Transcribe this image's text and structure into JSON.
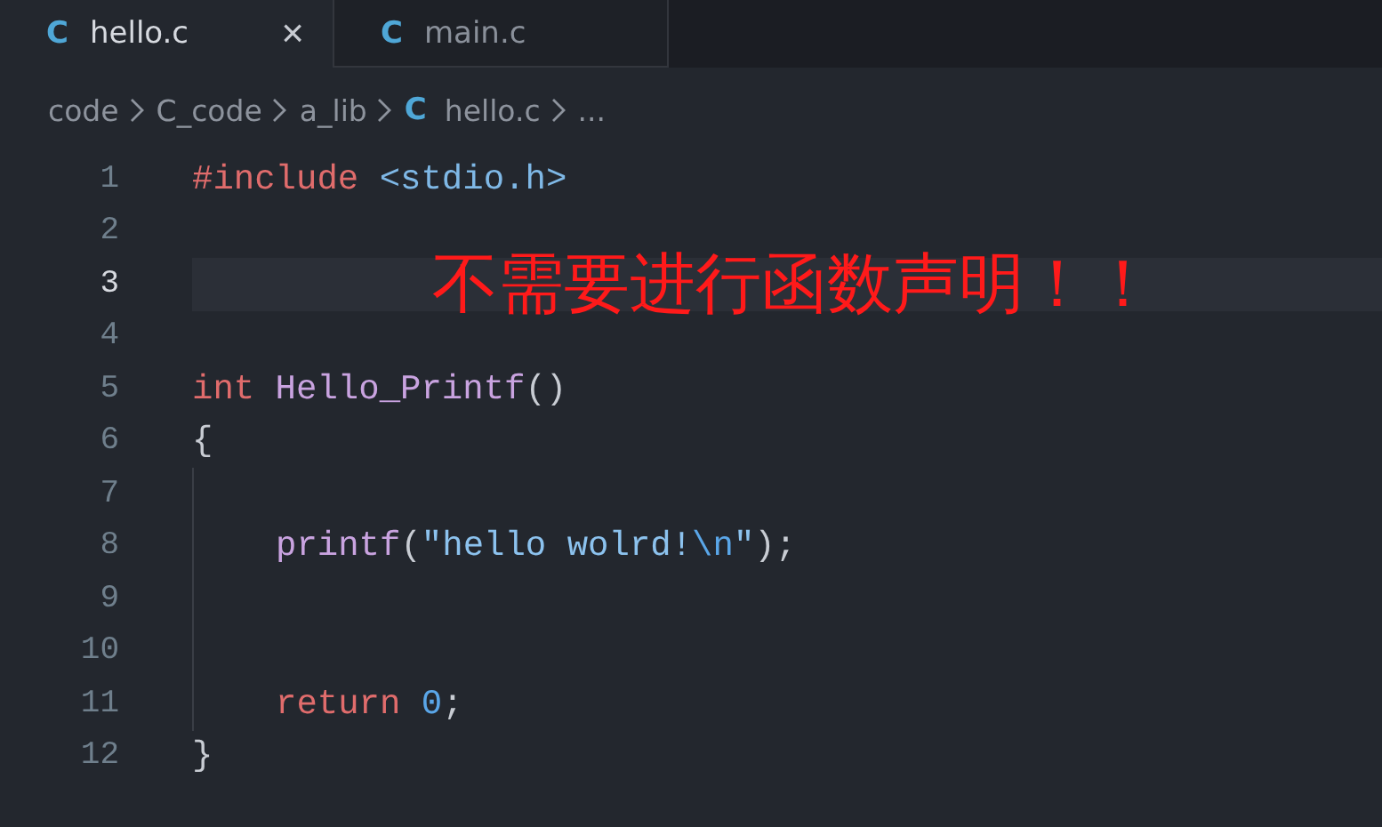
{
  "tabs": [
    {
      "icon": "C",
      "label": "hello.c",
      "selected": true,
      "close": "×"
    },
    {
      "icon": "C",
      "label": "main.c",
      "selected": false
    }
  ],
  "breadcrumb": [
    {
      "label": "code"
    },
    {
      "label": "C_code"
    },
    {
      "label": "a_lib"
    },
    {
      "icon": "C",
      "label": "hello.c"
    },
    {
      "label": "..."
    }
  ],
  "lines": [
    {
      "number": "1",
      "current": false,
      "guide": false,
      "tokens": [
        {
          "kind": "keyword",
          "text": "#include"
        },
        {
          "kind": "path",
          "text": " <stdio.h>"
        }
      ]
    },
    {
      "number": "2",
      "current": false,
      "guide": false
    },
    {
      "number": "3",
      "current": true,
      "guide": false
    },
    {
      "number": "4",
      "current": false,
      "guide": false
    },
    {
      "number": "5",
      "current": false,
      "guide": false,
      "tokens": [
        {
          "kind": "keyword",
          "text": "int"
        },
        {
          "kind": "function",
          "text": " Hello_Printf"
        },
        {
          "kind": "plain",
          "text": "()"
        }
      ]
    },
    {
      "number": "6",
      "current": false,
      "guide": false,
      "tokens": [
        {
          "kind": "plain",
          "text": "{"
        }
      ]
    },
    {
      "number": "7",
      "current": false,
      "guide": true
    },
    {
      "number": "8",
      "current": false,
      "guide": true,
      "tokens": [
        {
          "kind": "function",
          "text": "printf"
        },
        {
          "kind": "plain",
          "text": "("
        },
        {
          "kind": "string",
          "text": "\"hello wolrd!"
        },
        {
          "kind": "escape",
          "text": "\\n"
        },
        {
          "kind": "string",
          "text": "\""
        },
        {
          "kind": "plain",
          "text": ");"
        }
      ]
    },
    {
      "number": "9",
      "current": false,
      "guide": true
    },
    {
      "number": "10",
      "current": false,
      "guide": true
    },
    {
      "number": "11",
      "current": false,
      "guide": true,
      "tokens": [
        {
          "kind": "keyword",
          "text": "return"
        },
        {
          "kind": "number",
          "text": " 0"
        },
        {
          "kind": "plain",
          "text": ";"
        }
      ]
    },
    {
      "number": "12",
      "current": false,
      "guide": false,
      "tokens": [
        {
          "kind": "plain",
          "text": "}"
        }
      ]
    }
  ],
  "annotation": {
    "text": "不需要进行函数声明！！"
  }
}
